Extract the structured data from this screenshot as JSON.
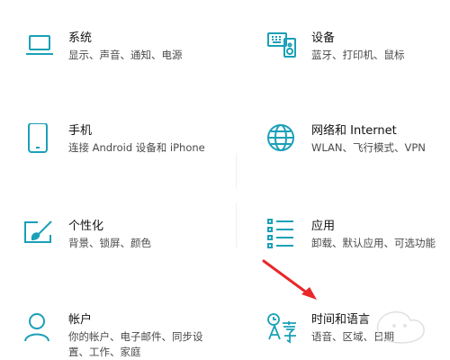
{
  "tiles": [
    {
      "id": "system",
      "title": "系统",
      "desc": "显示、声音、通知、电源",
      "icon": "laptop-icon"
    },
    {
      "id": "devices",
      "title": "设备",
      "desc": "蓝牙、打印机、鼠标",
      "icon": "keyboard-speaker-icon"
    },
    {
      "id": "phone",
      "title": "手机",
      "desc": "连接 Android 设备和 iPhone",
      "icon": "phone-icon"
    },
    {
      "id": "network",
      "title": "网络和 Internet",
      "desc": "WLAN、飞行模式、VPN",
      "icon": "globe-icon"
    },
    {
      "id": "personalization",
      "title": "个性化",
      "desc": "背景、锁屏、颜色",
      "icon": "paint-brush-icon"
    },
    {
      "id": "apps",
      "title": "应用",
      "desc": "卸载、默认应用、可选功能",
      "icon": "list-icon"
    },
    {
      "id": "accounts",
      "title": "帐户",
      "desc_line1": "你的帐户、电子邮件、同步设",
      "desc_line2": "置、工作、家庭",
      "icon": "person-icon"
    },
    {
      "id": "time-language",
      "title": "时间和语言",
      "desc": "语音、区域、日期",
      "icon": "language-time-icon"
    }
  ],
  "colors": {
    "accent": "#1aa0b8",
    "arrow": "#e8272a"
  }
}
